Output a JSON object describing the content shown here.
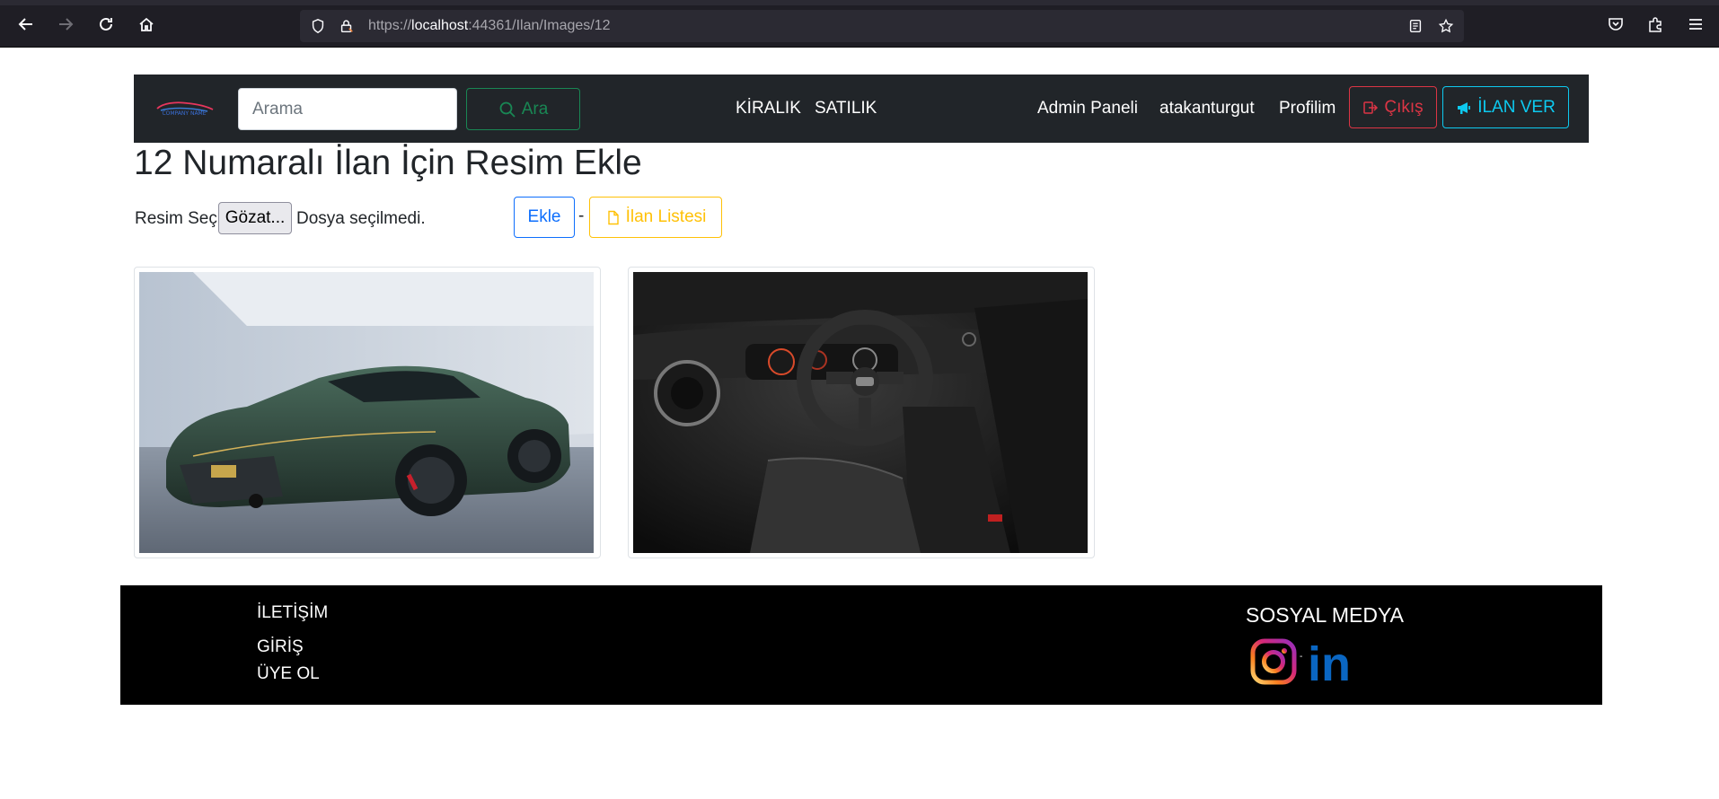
{
  "browser": {
    "url_prefix": "https://",
    "url_host": "localhost",
    "url_rest": ":44361/Ilan/Images/12"
  },
  "navbar": {
    "logo_text": "COMPANY NAME",
    "search_placeholder": "Arama",
    "search_button": "Ara",
    "links": {
      "kiralik": "KİRALIK",
      "satilik": "SATILIK",
      "admin": "Admin Paneli",
      "username": "atakanturgut",
      "profile": "Profilim"
    },
    "logout_button": "Çıkış",
    "post_ad_button": "İLAN VER"
  },
  "page": {
    "title": "12 Numaralı İlan İçin Resim Ekle",
    "file_label": "Resim Seç",
    "browse_button": "Gözat...",
    "no_file_text": "Dosya seçilmedi.",
    "add_button": "Ekle",
    "separator": "-",
    "list_button": "İlan Listesi"
  },
  "images": [
    {
      "description_icon": "car-exterior-image"
    },
    {
      "description_icon": "car-interior-image"
    }
  ],
  "footer": {
    "links": [
      "İLETİŞİM",
      "GİRİŞ",
      "ÜYE OL"
    ],
    "social_title": "SOSYAL MEDYA",
    "social_separator": "-",
    "linkedin_text": "in"
  },
  "colors": {
    "navbar_bg": "#212529",
    "success": "#198754",
    "danger": "#dc3545",
    "info": "#0dcaf0",
    "primary": "#0d6efd",
    "warning": "#ffc107",
    "linkedin": "#0a66c2"
  }
}
